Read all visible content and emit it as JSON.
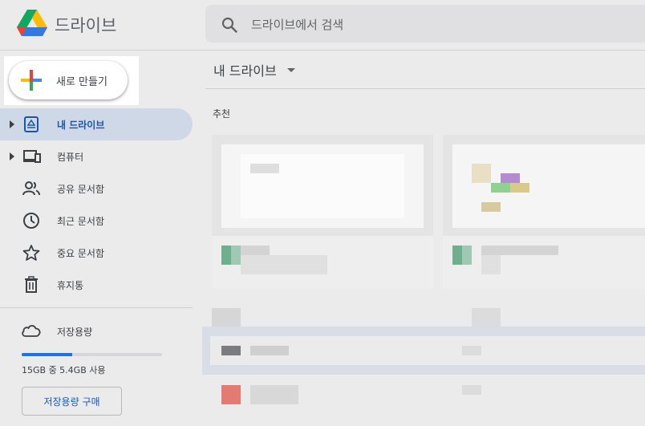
{
  "header": {
    "app_title": "드라이브",
    "logo_icon": "google-drive-logo",
    "search_placeholder": "드라이브에서 검색"
  },
  "sidebar": {
    "new_button_label": "새로 만들기",
    "items": [
      {
        "label": "내 드라이브",
        "icon": "my-drive-icon",
        "active": true,
        "expandable": true
      },
      {
        "label": "컴퓨터",
        "icon": "computer-icon",
        "active": false,
        "expandable": true
      },
      {
        "label": "공유 문서함",
        "icon": "shared-people-icon",
        "active": false,
        "expandable": false
      },
      {
        "label": "최근 문서함",
        "icon": "clock-icon",
        "active": false,
        "expandable": false
      },
      {
        "label": "중요 문서함",
        "icon": "star-icon",
        "active": false,
        "expandable": false
      },
      {
        "label": "휴지통",
        "icon": "trash-icon",
        "active": false,
        "expandable": false
      }
    ],
    "storage": {
      "label": "저장용량",
      "usage_text": "15GB 중 5.4GB 사용",
      "used_fraction": 0.36,
      "buy_button_label": "저장용량 구매"
    }
  },
  "main": {
    "title": "내 드라이브",
    "section_label": "추천"
  },
  "colors": {
    "accent": "#1a73e8",
    "active_nav_bg": "#cfd8e6",
    "active_nav_text": "#1a56b0",
    "background": "#ebebeb"
  }
}
